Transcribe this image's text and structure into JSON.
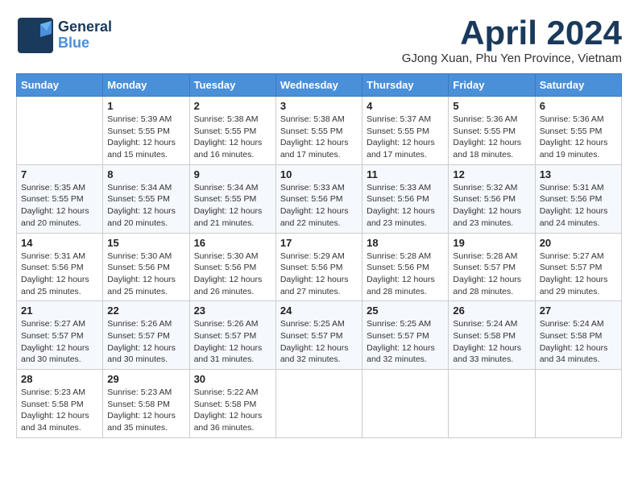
{
  "header": {
    "logo_general": "General",
    "logo_blue": "Blue",
    "month_title": "April 2024",
    "subtitle": "GJong Xuan, Phu Yen Province, Vietnam"
  },
  "days_of_week": [
    "Sunday",
    "Monday",
    "Tuesday",
    "Wednesday",
    "Thursday",
    "Friday",
    "Saturday"
  ],
  "weeks": [
    [
      {
        "day": "",
        "detail": ""
      },
      {
        "day": "1",
        "detail": "Sunrise: 5:39 AM\nSunset: 5:55 PM\nDaylight: 12 hours\nand 15 minutes."
      },
      {
        "day": "2",
        "detail": "Sunrise: 5:38 AM\nSunset: 5:55 PM\nDaylight: 12 hours\nand 16 minutes."
      },
      {
        "day": "3",
        "detail": "Sunrise: 5:38 AM\nSunset: 5:55 PM\nDaylight: 12 hours\nand 17 minutes."
      },
      {
        "day": "4",
        "detail": "Sunrise: 5:37 AM\nSunset: 5:55 PM\nDaylight: 12 hours\nand 17 minutes."
      },
      {
        "day": "5",
        "detail": "Sunrise: 5:36 AM\nSunset: 5:55 PM\nDaylight: 12 hours\nand 18 minutes."
      },
      {
        "day": "6",
        "detail": "Sunrise: 5:36 AM\nSunset: 5:55 PM\nDaylight: 12 hours\nand 19 minutes."
      }
    ],
    [
      {
        "day": "7",
        "detail": "Sunrise: 5:35 AM\nSunset: 5:55 PM\nDaylight: 12 hours\nand 20 minutes."
      },
      {
        "day": "8",
        "detail": "Sunrise: 5:34 AM\nSunset: 5:55 PM\nDaylight: 12 hours\nand 20 minutes."
      },
      {
        "day": "9",
        "detail": "Sunrise: 5:34 AM\nSunset: 5:55 PM\nDaylight: 12 hours\nand 21 minutes."
      },
      {
        "day": "10",
        "detail": "Sunrise: 5:33 AM\nSunset: 5:56 PM\nDaylight: 12 hours\nand 22 minutes."
      },
      {
        "day": "11",
        "detail": "Sunrise: 5:33 AM\nSunset: 5:56 PM\nDaylight: 12 hours\nand 23 minutes."
      },
      {
        "day": "12",
        "detail": "Sunrise: 5:32 AM\nSunset: 5:56 PM\nDaylight: 12 hours\nand 23 minutes."
      },
      {
        "day": "13",
        "detail": "Sunrise: 5:31 AM\nSunset: 5:56 PM\nDaylight: 12 hours\nand 24 minutes."
      }
    ],
    [
      {
        "day": "14",
        "detail": "Sunrise: 5:31 AM\nSunset: 5:56 PM\nDaylight: 12 hours\nand 25 minutes."
      },
      {
        "day": "15",
        "detail": "Sunrise: 5:30 AM\nSunset: 5:56 PM\nDaylight: 12 hours\nand 25 minutes."
      },
      {
        "day": "16",
        "detail": "Sunrise: 5:30 AM\nSunset: 5:56 PM\nDaylight: 12 hours\nand 26 minutes."
      },
      {
        "day": "17",
        "detail": "Sunrise: 5:29 AM\nSunset: 5:56 PM\nDaylight: 12 hours\nand 27 minutes."
      },
      {
        "day": "18",
        "detail": "Sunrise: 5:28 AM\nSunset: 5:56 PM\nDaylight: 12 hours\nand 28 minutes."
      },
      {
        "day": "19",
        "detail": "Sunrise: 5:28 AM\nSunset: 5:57 PM\nDaylight: 12 hours\nand 28 minutes."
      },
      {
        "day": "20",
        "detail": "Sunrise: 5:27 AM\nSunset: 5:57 PM\nDaylight: 12 hours\nand 29 minutes."
      }
    ],
    [
      {
        "day": "21",
        "detail": "Sunrise: 5:27 AM\nSunset: 5:57 PM\nDaylight: 12 hours\nand 30 minutes."
      },
      {
        "day": "22",
        "detail": "Sunrise: 5:26 AM\nSunset: 5:57 PM\nDaylight: 12 hours\nand 30 minutes."
      },
      {
        "day": "23",
        "detail": "Sunrise: 5:26 AM\nSunset: 5:57 PM\nDaylight: 12 hours\nand 31 minutes."
      },
      {
        "day": "24",
        "detail": "Sunrise: 5:25 AM\nSunset: 5:57 PM\nDaylight: 12 hours\nand 32 minutes."
      },
      {
        "day": "25",
        "detail": "Sunrise: 5:25 AM\nSunset: 5:57 PM\nDaylight: 12 hours\nand 32 minutes."
      },
      {
        "day": "26",
        "detail": "Sunrise: 5:24 AM\nSunset: 5:58 PM\nDaylight: 12 hours\nand 33 minutes."
      },
      {
        "day": "27",
        "detail": "Sunrise: 5:24 AM\nSunset: 5:58 PM\nDaylight: 12 hours\nand 34 minutes."
      }
    ],
    [
      {
        "day": "28",
        "detail": "Sunrise: 5:23 AM\nSunset: 5:58 PM\nDaylight: 12 hours\nand 34 minutes."
      },
      {
        "day": "29",
        "detail": "Sunrise: 5:23 AM\nSunset: 5:58 PM\nDaylight: 12 hours\nand 35 minutes."
      },
      {
        "day": "30",
        "detail": "Sunrise: 5:22 AM\nSunset: 5:58 PM\nDaylight: 12 hours\nand 36 minutes."
      },
      {
        "day": "",
        "detail": ""
      },
      {
        "day": "",
        "detail": ""
      },
      {
        "day": "",
        "detail": ""
      },
      {
        "day": "",
        "detail": ""
      }
    ]
  ]
}
